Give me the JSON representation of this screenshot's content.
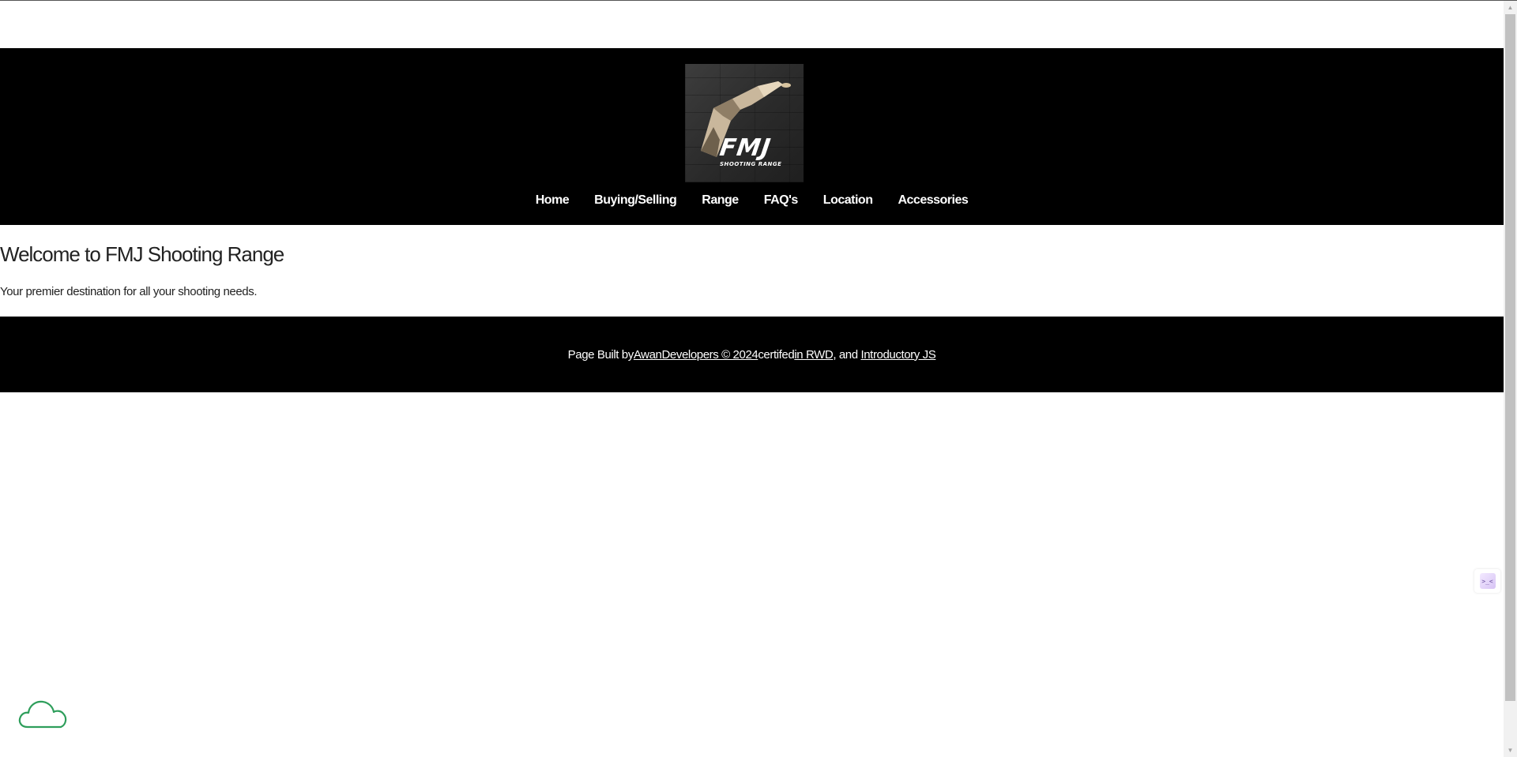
{
  "header": {
    "logo": {
      "title": "FMJ",
      "subtitle": "SHOOTING RANGE"
    },
    "nav": [
      {
        "label": "Home"
      },
      {
        "label": "Buying/Selling"
      },
      {
        "label": "Range"
      },
      {
        "label": "FAQ's"
      },
      {
        "label": "Location"
      },
      {
        "label": "Accessories"
      }
    ]
  },
  "main": {
    "heading": "Welcome to FMJ Shooting Range",
    "tagline": "Your premier destination for all your shooting needs."
  },
  "footer": {
    "prefix": "Page Built by",
    "author_link": " AwanDevelopers © 2024",
    "middle": " certifed",
    "rwd_link": " in RWD",
    "joiner": ", and ",
    "js_link": "Introductory JS"
  },
  "widgets": {
    "extension_glyph": ">_<",
    "cloud_icon": "cloud-icon",
    "cloud_color": "#2e9e5b"
  },
  "colors": {
    "header_bg": "#000000",
    "footer_bg": "#000000",
    "text": "#222222",
    "nav_text": "#ffffff"
  }
}
